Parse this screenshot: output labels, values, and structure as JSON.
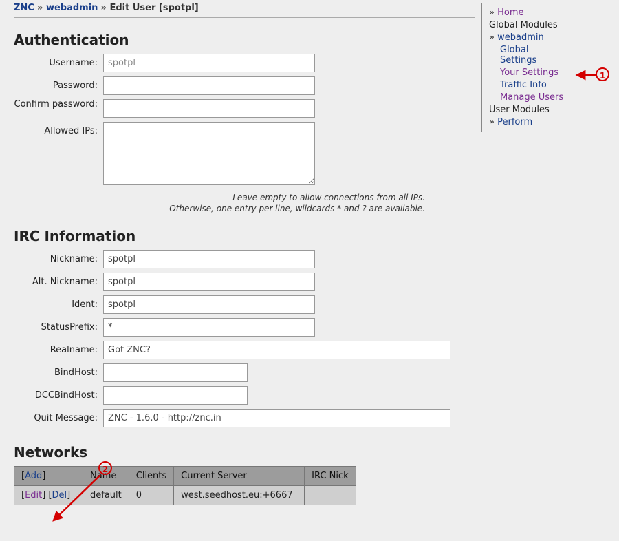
{
  "breadcrumb": {
    "root": "ZNC",
    "mid": "webadmin",
    "leaf": "Edit User [spotpl]"
  },
  "sections": {
    "auth": "Authentication",
    "irc": "IRC Information",
    "net": "Networks"
  },
  "auth": {
    "username_label": "Username:",
    "username_value": "spotpl",
    "password_label": "Password:",
    "confirm_label": "Confirm password:",
    "allowed_ips_label": "Allowed IPs:",
    "hint_l1": "Leave empty to allow connections from all IPs.",
    "hint_l2": "Otherwise, one entry per line, wildcards * and ? are available."
  },
  "irc": {
    "nick_label": "Nickname:",
    "nick_value": "spotpl",
    "altnick_label": "Alt. Nickname:",
    "altnick_value": "spotpl",
    "ident_label": "Ident:",
    "ident_value": "spotpl",
    "statusprefix_label": "StatusPrefix:",
    "statusprefix_value": "*",
    "realname_label": "Realname:",
    "realname_value": "Got ZNC?",
    "bindhost_label": "BindHost:",
    "bindhost_value": "",
    "dccbindhost_label": "DCCBindHost:",
    "dccbindhost_value": "",
    "quitmsg_label": "Quit Message:",
    "quitmsg_value": "ZNC - 1.6.0 - http://znc.in"
  },
  "networks": {
    "add": "Add",
    "edit": "Edit",
    "del": "Del",
    "headers": {
      "actions": "",
      "name": "Name",
      "clients": "Clients",
      "server": "Current Server",
      "ircnick": "IRC Nick"
    },
    "rows": [
      {
        "name": "default",
        "clients": "0",
        "server": "west.seedhost.eu:+6667",
        "ircnick": ""
      }
    ]
  },
  "sidebar": {
    "home": "Home",
    "global_modules": "Global Modules",
    "webadmin": "webadmin",
    "global_settings_l1": "Global",
    "global_settings_l2": "Settings",
    "your_settings": "Your Settings",
    "traffic_info": "Traffic Info",
    "manage_users": "Manage Users",
    "user_modules": "User Modules",
    "perform": "Perform"
  },
  "annotations": {
    "n1": "1",
    "n2": "2"
  }
}
